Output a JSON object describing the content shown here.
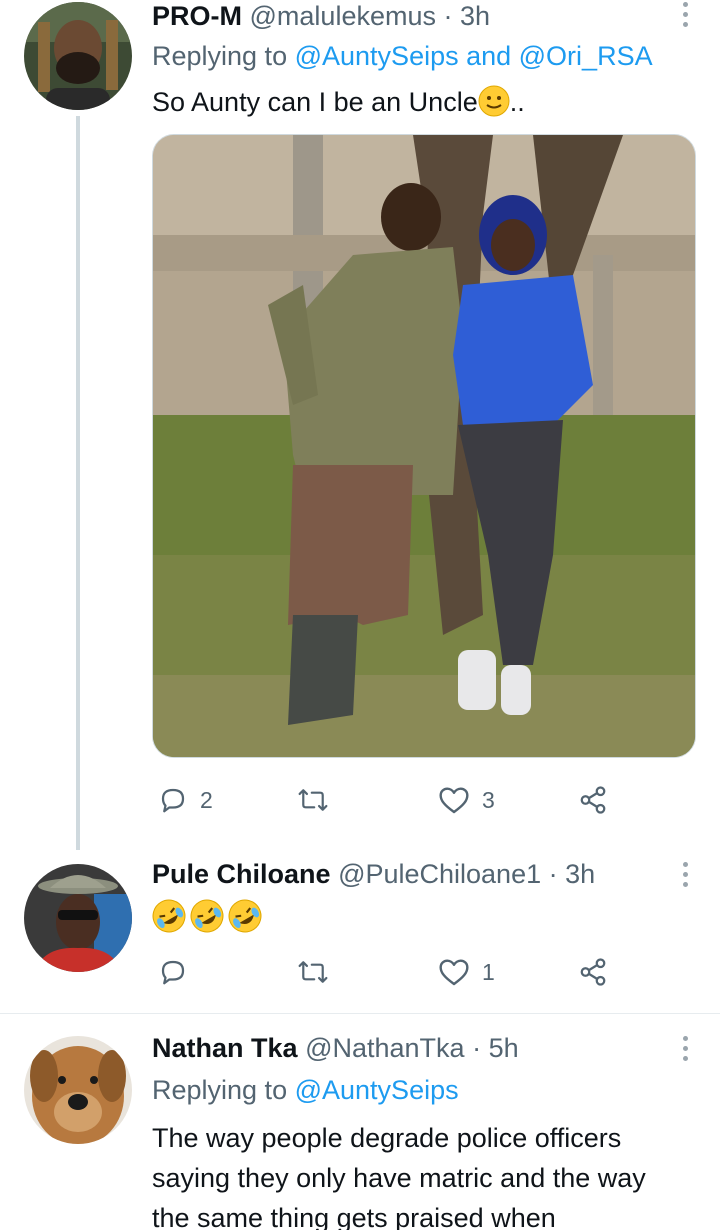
{
  "tweets": [
    {
      "name": "PRO-M",
      "handle": "@malulekemus",
      "dot": "·",
      "time": "3h",
      "reply_prefix": "Replying to",
      "reply_mentions": "@AuntySeips and @Ori_RSA",
      "text": "So Aunty can I be an Uncle",
      "text_suffix": "..",
      "replies": "2",
      "retweets": "",
      "likes": "3"
    },
    {
      "name": "Pule Chiloane",
      "handle": "@PuleChiloane1",
      "dot": "·",
      "time": "3h",
      "emoji_count": 3,
      "replies": "",
      "retweets": "",
      "likes": "1"
    },
    {
      "name": "Nathan Tka",
      "handle": "@NathanTka",
      "dot": "·",
      "time": "5h",
      "reply_prefix": "Replying to",
      "reply_mentions": "@AuntySeips",
      "text_lines": [
        "The way people degrade police officers",
        "saying they only have matric and the way",
        "the same thing gets praised when"
      ]
    }
  ],
  "icons": {
    "reply": "reply-icon",
    "retweet": "retweet-icon",
    "like": "heart-icon",
    "share": "share-icon",
    "more": "more-vertical-icon"
  },
  "colors": {
    "link": "#1d9bf0",
    "secondary": "#536471",
    "divider": "#e7ecef"
  }
}
